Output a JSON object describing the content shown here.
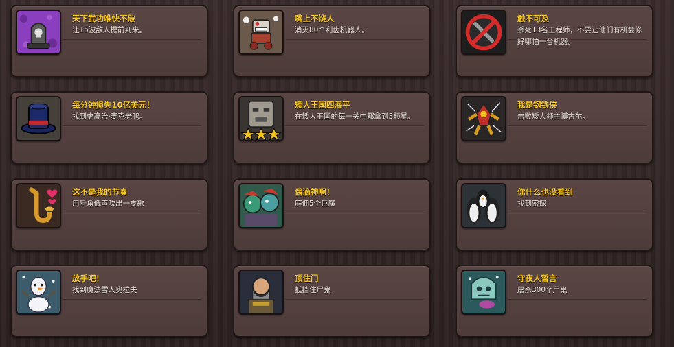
{
  "achievements": [
    {
      "title": "天下武功唯快不破",
      "desc": "让15波敌人提前到来。",
      "icon": "tombstone-icon",
      "bg": "#8a3fbf"
    },
    {
      "title": "嘴上不饶人",
      "desc": "消灭80个利齿机器人。",
      "icon": "robot-icon",
      "bg": "#6b5a4c"
    },
    {
      "title": "触不可及",
      "desc": "杀死13名工程师，不要让他们有机会修好哪怕一台机器。",
      "icon": "no-wrench-icon",
      "bg": "#1d1d1d"
    },
    {
      "title": "每分钟损失10亿美元！",
      "desc": "找到史高治·麦克老鸭。",
      "icon": "top-hat-icon",
      "bg": "#46403a"
    },
    {
      "title": "矮人王国四海平",
      "desc": "在矮人王国的每一关中都拿到3颗星。",
      "icon": "stone-face-stars-icon",
      "bg": "#3a3530"
    },
    {
      "title": "我是钢铁侠",
      "desc": "击败矮人领主博古尔。",
      "icon": "iron-mech-icon",
      "bg": "#2b2626"
    },
    {
      "title": "这不是我的节奏",
      "desc": "用号角低声吹出一支歌",
      "icon": "saxophone-icon",
      "bg": "#3a2a22"
    },
    {
      "title": "偶滴神啊！",
      "desc": "庭佣5个巨魔",
      "icon": "trolls-icon",
      "bg": "#2f5a4c"
    },
    {
      "title": "你什么也没看到",
      "desc": "找到密探",
      "icon": "penguins-icon",
      "bg": "#2c3236"
    },
    {
      "title": "放手吧！",
      "desc": "找到魔法雪人奥拉夫",
      "icon": "snowman-icon",
      "bg": "#3c5c6c"
    },
    {
      "title": "顶住门",
      "desc": "抵挡住尸鬼",
      "icon": "dwarf-guard-icon",
      "bg": "#2a2e3a"
    },
    {
      "title": "守夜人誓言",
      "desc": "屠杀300个尸鬼",
      "icon": "ghoul-icon",
      "bg": "#2c5a5c"
    }
  ]
}
